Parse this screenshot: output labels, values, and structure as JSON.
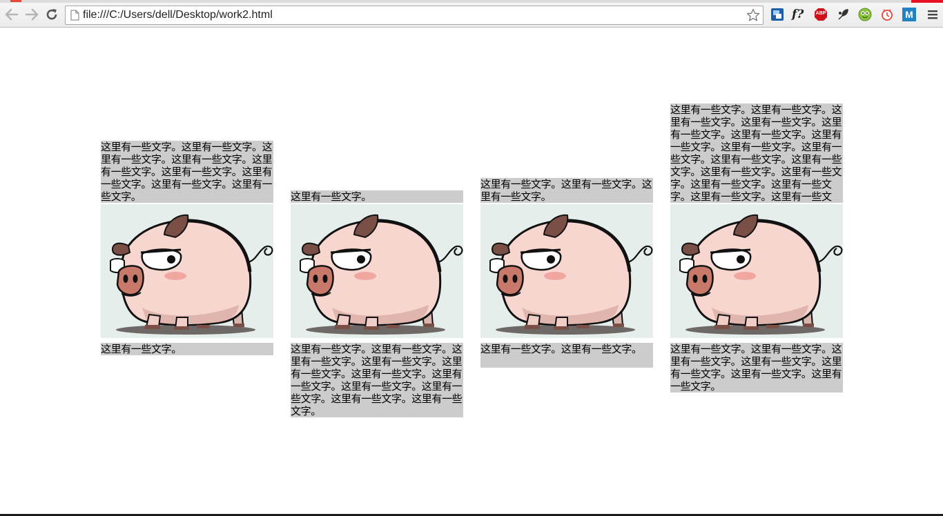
{
  "browser": {
    "url": "file:///C:/Users/dell/Desktop/work2.html",
    "icons": [
      "back-arrow-icon",
      "forward-arrow-icon",
      "reload-icon",
      "page-icon",
      "bookmark-star-icon",
      "extension-icon",
      "font-query-icon",
      "adblock-plus-icon",
      "extension-icon",
      "green-face-icon",
      "timer-icon",
      "m-extension-icon",
      "menu-icon"
    ],
    "ext_labels": {
      "font": "f?",
      "abp": "ABP",
      "m": "M"
    }
  },
  "columns": [
    {
      "top_text": "这里有一些文字。这里有一些文字。这里有一些文字。这里有一些文字。这里有一些文字。这里有一些文字。这里有一些文字。这里有一些文字。这里有一些文字。",
      "bottom_text": "这里有一些文字。"
    },
    {
      "top_text": "这里有一些文字。",
      "bottom_text": "这里有一些文字。这里有一些文字。这里有一些文字。这里有一些文字。这里有一些文字。这里有一些文字。这里有一些文字。这里有一些文字。这里有一些文字。这里有一些文字。这里有一些文字。"
    },
    {
      "top_text": "这里有一些文字。这里有一些文字。这里有一些文字。",
      "bottom_text": "这里有一些文字。这里有一些文字。"
    },
    {
      "top_text": "这里有一些文字。这里有一些文字。这里有一些文字。这里有一些文字。这里有一些文字。这里有一些文字。这里有一些文字。这里有一些文字。这里有一些文字。这里有一些文字。这里有一些文字。这里有一些文字。这里有一些文字。这里有一些文字。这里有一些文字。这里有一些文字。这里有一些文字。这里有一些文字。",
      "bottom_text": "这里有一些文字。这里有一些文字。这里有一些文字。这里有一些文字。这里有一些文字。这里有一些文字。这里有一些文字。"
    }
  ],
  "colors": {
    "text_block_bg": "#cccccc",
    "image_bg": "#e6eeec",
    "pig_body": "#f7d6cf",
    "pig_outline": "#1a1a1a",
    "pig_ear": "#7a4f45",
    "pig_snout": "#c8796a"
  }
}
